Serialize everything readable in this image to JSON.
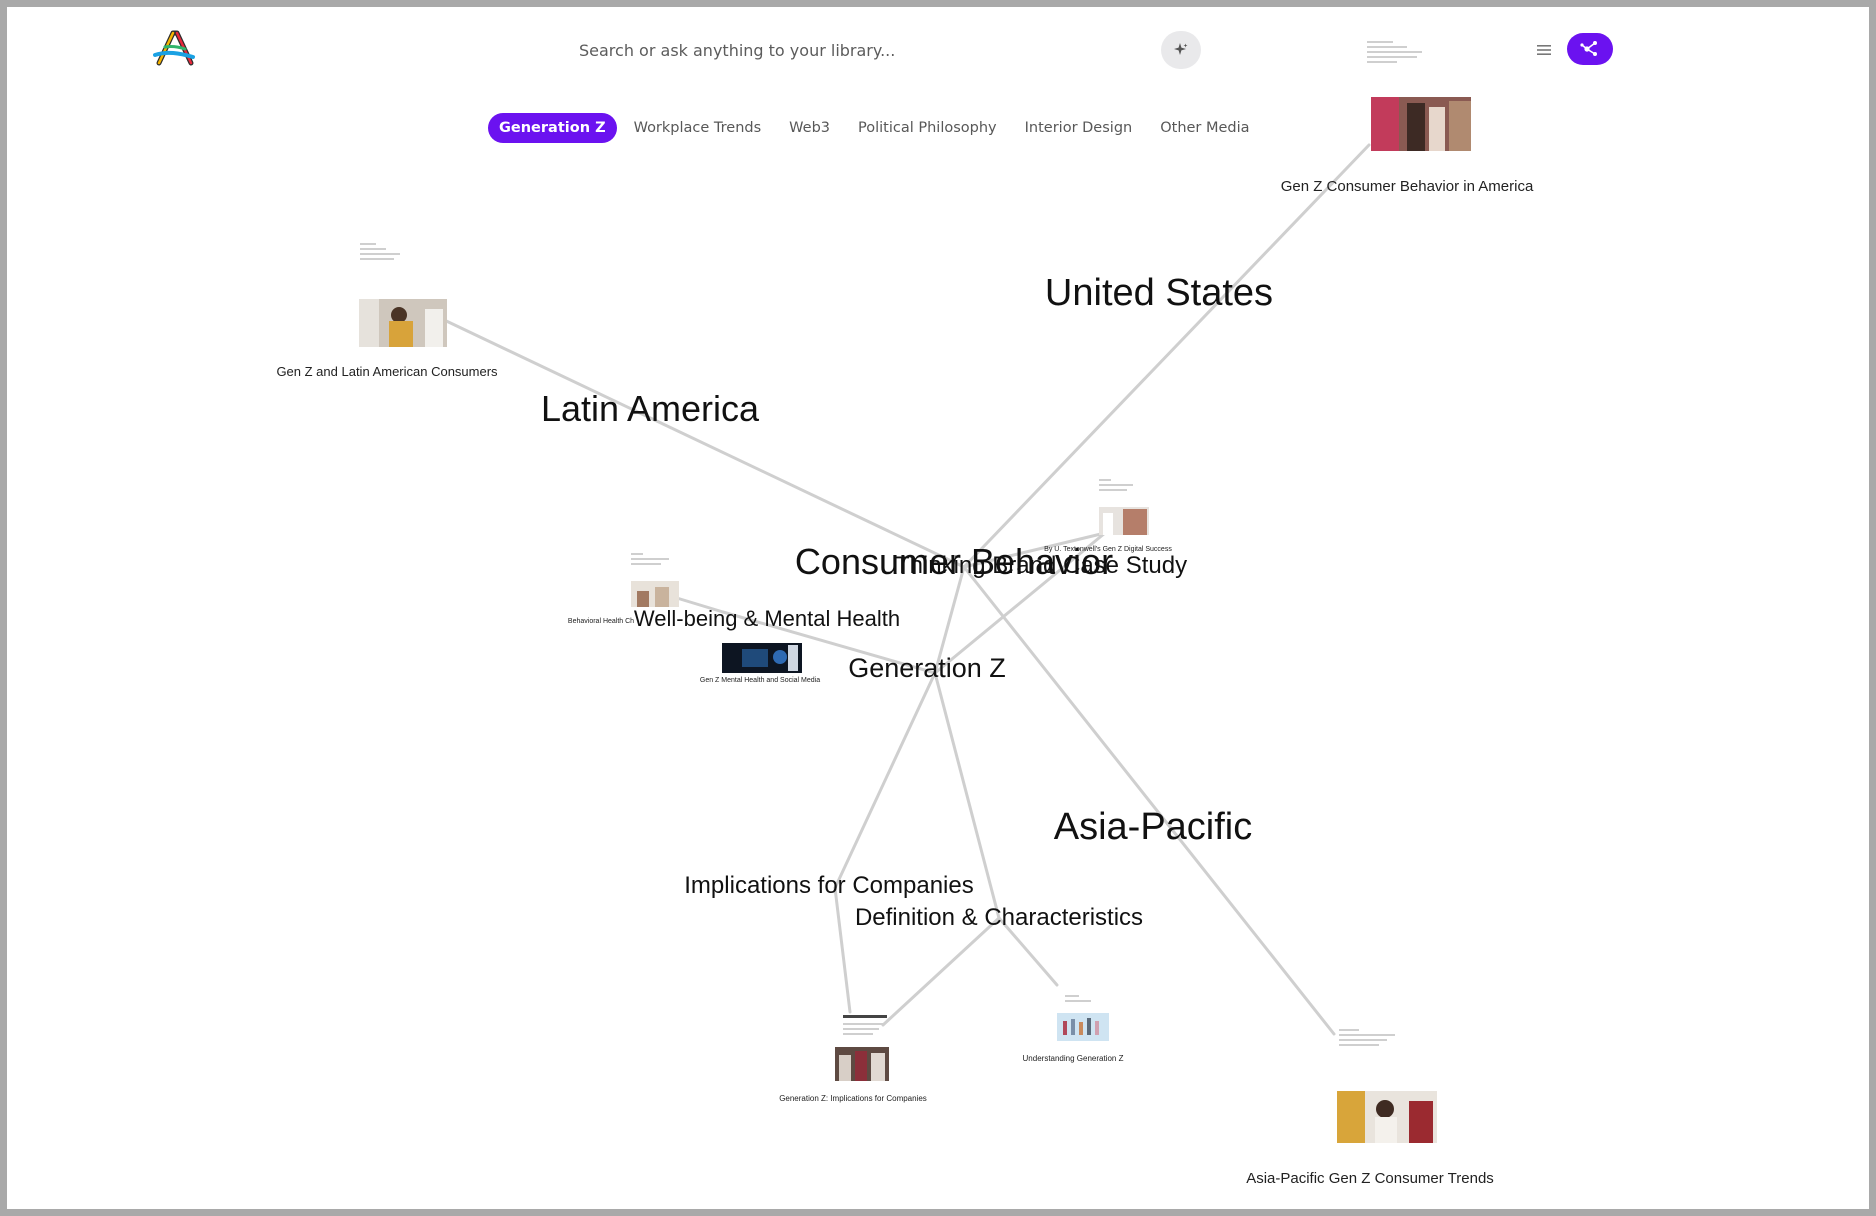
{
  "search": {
    "placeholder": "Search or ask anything to your library..."
  },
  "toolbar": {
    "ai_icon": "sparkle-icon",
    "list_icon": "list-icon",
    "graph_icon": "graph-icon"
  },
  "colors": {
    "accent": "#6b12f0",
    "edge": "#cfcfcf",
    "text": "#111111"
  },
  "tabs": [
    {
      "label": "Generation Z",
      "active": true
    },
    {
      "label": "Workplace Trends"
    },
    {
      "label": "Web3"
    },
    {
      "label": "Political Philosophy"
    },
    {
      "label": "Interior Design"
    },
    {
      "label": "Other Media"
    }
  ],
  "graph": {
    "topics": {
      "united_states": "United States",
      "latin_america": "Latin America",
      "consumer_behavior": "Consumer Behavior",
      "case_study": "Thinking Brand Case Study",
      "wellbeing": "Well-being & Mental Health",
      "generation_z": "Generation Z",
      "asia_pacific": "Asia-Pacific",
      "implications": "Implications for Companies",
      "definition": "Definition & Characteristics"
    },
    "documents": {
      "us_consumer": "Gen Z Consumer Behavior in America",
      "latam_consumers": "Gen Z and Latin American Consumers",
      "digital_success": "By U. Textonwell's Gen Z Digital Success",
      "behavioral_health": "Behavioral Health Ch",
      "mental_health": "Gen Z Mental Health and Social Media",
      "implications_doc": "Generation Z: Implications for Companies",
      "understanding": "Understanding Generation Z",
      "apac_trends": "Asia-Pacific Gen Z Consumer Trends"
    }
  }
}
